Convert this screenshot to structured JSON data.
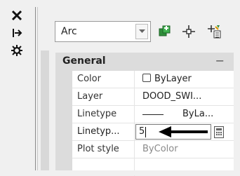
{
  "toolstrip": {
    "icons": [
      "close-icon",
      "pin-icon",
      "properties-settings-icon"
    ]
  },
  "combo": {
    "value": "Arc"
  },
  "toolbar_icons": [
    "quick-select-icon",
    "select-objects-icon",
    "toggle-pickadd-icon"
  ],
  "section": {
    "title": "General",
    "toggle": "−"
  },
  "rows": [
    {
      "name": "Color",
      "value": "ByLayer",
      "swatch": "#ffffff"
    },
    {
      "name": "Layer",
      "value": "DOOD_SWI..."
    },
    {
      "name": "Linetype",
      "value": "ByLa..."
    },
    {
      "name": "Linetyp...",
      "value": "5"
    },
    {
      "name": "Plot style",
      "value": "ByColor"
    }
  ],
  "colors": {
    "section_bg": "#dcdcdc",
    "accent_arrow": "#000000",
    "muted": "#8a8a8a"
  }
}
